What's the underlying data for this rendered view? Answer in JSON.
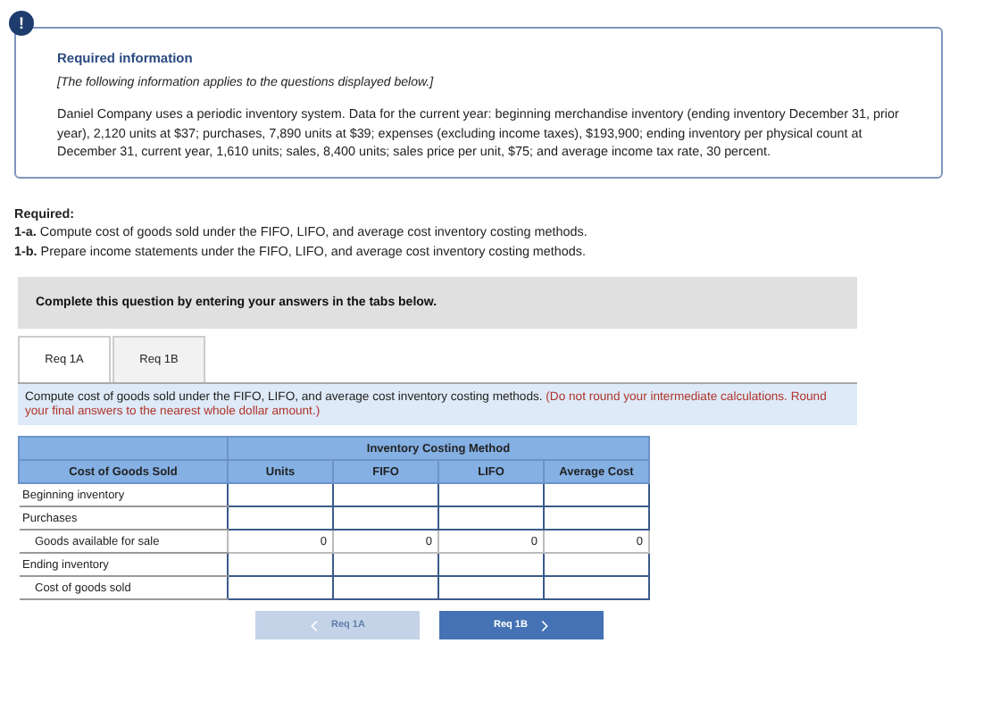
{
  "info": {
    "icon": "!",
    "title": "Required information",
    "note": "[The following information applies to the questions displayed below.]",
    "body": "Daniel Company uses a periodic inventory system. Data for the current year: beginning merchandise inventory (ending inventory December 31, prior year), 2,120 units at $37; purchases, 7,890 units at $39; expenses (excluding income taxes), $193,900; ending inventory per physical count at December 31, current year, 1,610 units; sales, 8,400 units; sales price per unit, $75; and average income tax rate, 30 percent."
  },
  "required": {
    "heading": "Required:",
    "items": [
      {
        "label": "1-a.",
        "text": "Compute cost of goods sold under the FIFO, LIFO, and average cost inventory costing methods."
      },
      {
        "label": "1-b.",
        "text": "Prepare income statements under the FIFO, LIFO, and average cost inventory costing methods."
      }
    ]
  },
  "banner": "Complete this question by entering your answers in the tabs below.",
  "tabs": [
    {
      "label": "Req 1A",
      "selected": true
    },
    {
      "label": "Req 1B",
      "selected": false
    }
  ],
  "instruction": {
    "text": "Compute cost of goods sold under the FIFO, LIFO, and average cost inventory costing methods.",
    "warning": "(Do not round your intermediate calculations. Round your final answers to the nearest whole dollar amount.)"
  },
  "table": {
    "group_heading": "Inventory Costing Method",
    "columns": [
      "Cost of Goods Sold",
      "Units",
      "FIFO",
      "LIFO",
      "Average Cost"
    ],
    "rows": [
      {
        "label": "Beginning inventory",
        "indented": false,
        "kind": "input"
      },
      {
        "label": "Purchases",
        "indented": false,
        "kind": "input"
      },
      {
        "label": "Goods available for sale",
        "indented": true,
        "kind": "total",
        "values": [
          "0",
          "0",
          "0",
          "0"
        ]
      },
      {
        "label": "Ending inventory",
        "indented": false,
        "kind": "input"
      },
      {
        "label": "Cost of goods sold",
        "indented": true,
        "kind": "input"
      }
    ]
  },
  "nav": [
    {
      "label": "Req 1A",
      "kind": "prev",
      "disabled": true
    },
    {
      "label": "Req 1B",
      "kind": "next",
      "disabled": false
    }
  ]
}
